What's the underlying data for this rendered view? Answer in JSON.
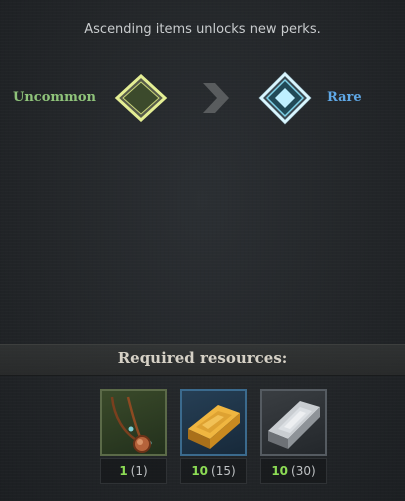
{
  "header": {
    "text": "Ascending items unlocks new perks."
  },
  "ascension": {
    "from": {
      "label": "Uncommon",
      "color": "#8fc37a",
      "icon": "uncommon-rarity-diamond"
    },
    "arrow_icon": "chevron-right-icon",
    "to": {
      "label": "Rare",
      "color": "#5fa8e6",
      "icon": "rare-rarity-diamond"
    }
  },
  "resources": {
    "title": "Required resources:",
    "items": [
      {
        "icon": "amulet-pendant-icon",
        "required": "1",
        "owned": "(1)"
      },
      {
        "icon": "gold-ingot-icon",
        "required": "10",
        "owned": "(15)"
      },
      {
        "icon": "silver-ingot-icon",
        "required": "10",
        "owned": "(30)"
      }
    ]
  }
}
